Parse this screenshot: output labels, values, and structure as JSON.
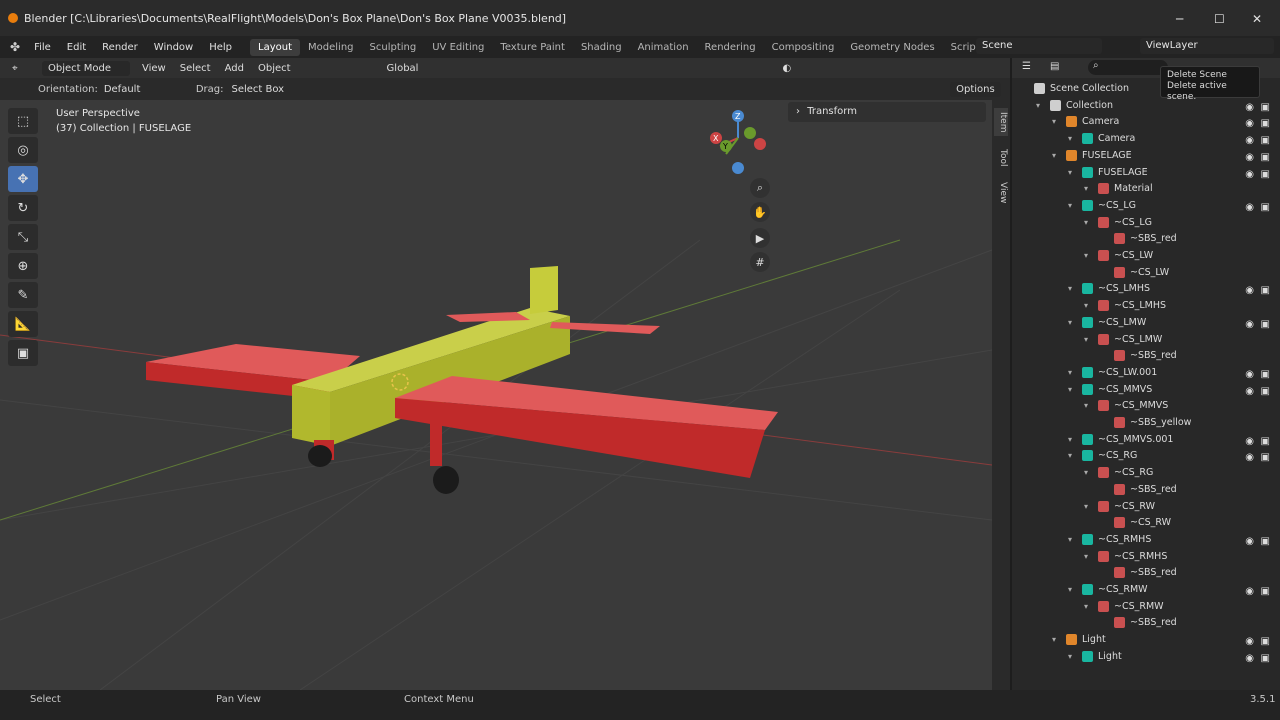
{
  "window": {
    "title": "Blender [C:\\Libraries\\Documents\\RealFlight\\Models\\Don's Box Plane\\Don's Box Plane V0035.blend]",
    "minimize": "─",
    "maximize": "☐",
    "close": "✕"
  },
  "menu": [
    "File",
    "Edit",
    "Render",
    "Window",
    "Help"
  ],
  "workspaces": [
    "Layout",
    "Modeling",
    "Sculpting",
    "UV Editing",
    "Texture Paint",
    "Shading",
    "Animation",
    "Rendering",
    "Compositing",
    "Geometry Nodes",
    "Scripting"
  ],
  "scene": {
    "label": "Scene",
    "viewlayer": "ViewLayer"
  },
  "header": {
    "mode": "Object Mode",
    "view": "View",
    "select": "Select",
    "add": "Add",
    "object": "Object",
    "transform_orient": "Global"
  },
  "toolheader": {
    "orientation_label": "Orientation:",
    "orientation": "Default",
    "drag_label": "Drag:",
    "drag": "Select Box",
    "options": "Options"
  },
  "viewport": {
    "perspective": "User Perspective",
    "collection": "(37) Collection | FUSELAGE",
    "panel": "Transform"
  },
  "vtabs": [
    "Item",
    "Tool",
    "View"
  ],
  "tooltip": {
    "title": "Delete Scene",
    "desc": "Delete active scene."
  },
  "outliner": [
    {
      "label": "Scene Collection",
      "depth": 0
    },
    {
      "label": "Collection",
      "depth": 1
    },
    {
      "label": "Camera",
      "depth": 2
    },
    {
      "label": "Camera",
      "depth": 3
    },
    {
      "label": "FUSELAGE",
      "depth": 2
    },
    {
      "label": "FUSELAGE",
      "depth": 3
    },
    {
      "label": "Material",
      "depth": 4
    },
    {
      "label": "~CS_LG",
      "depth": 3
    },
    {
      "label": "~CS_LG",
      "depth": 4
    },
    {
      "label": "~SBS_red",
      "depth": 5
    },
    {
      "label": "~CS_LW",
      "depth": 4
    },
    {
      "label": "~CS_LW",
      "depth": 5
    },
    {
      "label": "~CS_LMHS",
      "depth": 3
    },
    {
      "label": "~CS_LMHS",
      "depth": 4
    },
    {
      "label": "~CS_LMW",
      "depth": 3
    },
    {
      "label": "~CS_LMW",
      "depth": 4
    },
    {
      "label": "~SBS_red",
      "depth": 5
    },
    {
      "label": "~CS_LW.001",
      "depth": 3
    },
    {
      "label": "~CS_MMVS",
      "depth": 3
    },
    {
      "label": "~CS_MMVS",
      "depth": 4
    },
    {
      "label": "~SBS_yellow",
      "depth": 5
    },
    {
      "label": "~CS_MMVS.001",
      "depth": 3
    },
    {
      "label": "~CS_RG",
      "depth": 3
    },
    {
      "label": "~CS_RG",
      "depth": 4
    },
    {
      "label": "~SBS_red",
      "depth": 5
    },
    {
      "label": "~CS_RW",
      "depth": 4
    },
    {
      "label": "~CS_RW",
      "depth": 5
    },
    {
      "label": "~CS_RMHS",
      "depth": 3
    },
    {
      "label": "~CS_RMHS",
      "depth": 4
    },
    {
      "label": "~SBS_red",
      "depth": 5
    },
    {
      "label": "~CS_RMW",
      "depth": 3
    },
    {
      "label": "~CS_RMW",
      "depth": 4
    },
    {
      "label": "~SBS_red",
      "depth": 5
    },
    {
      "label": "Light",
      "depth": 2
    },
    {
      "label": "Light",
      "depth": 3
    }
  ],
  "status": {
    "select": "Select",
    "pan": "Pan View",
    "context": "Context Menu",
    "version": "3.5.1"
  },
  "gizmo": {
    "x": "X",
    "y": "Y",
    "z": "Z"
  }
}
